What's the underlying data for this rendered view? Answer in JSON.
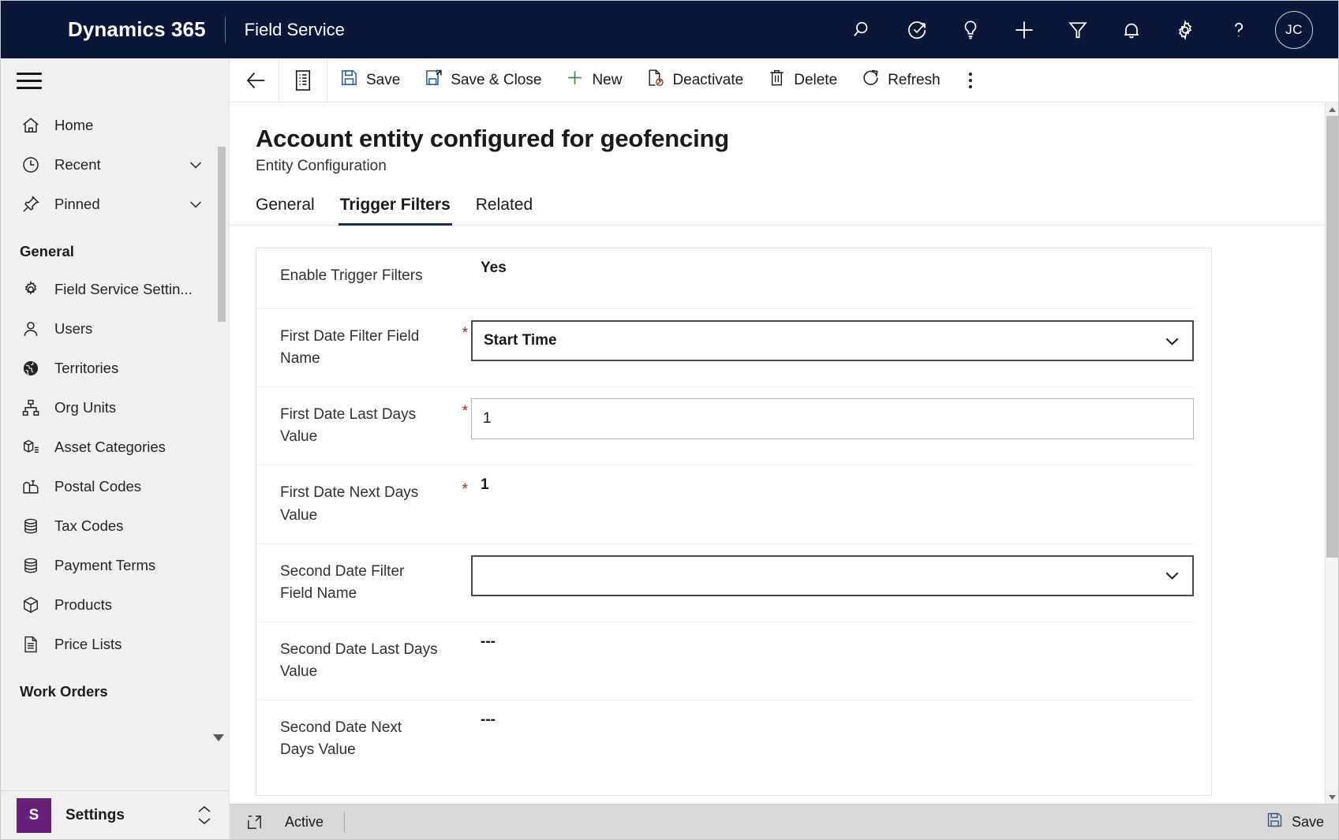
{
  "topbar": {
    "brand": "Dynamics 365",
    "app_name": "Field Service",
    "icons": [
      {
        "name": "search-icon",
        "label": "Search"
      },
      {
        "name": "assistant-check-icon",
        "label": "Assistant"
      },
      {
        "name": "lightbulb-icon",
        "label": "Ideas"
      },
      {
        "name": "plus-icon",
        "label": "Quick create"
      },
      {
        "name": "filter-funnel-icon",
        "label": "Filter"
      },
      {
        "name": "bell-icon",
        "label": "Notifications"
      },
      {
        "name": "gear-icon",
        "label": "Settings"
      },
      {
        "name": "question-icon",
        "label": "Help"
      }
    ],
    "avatar_initials": "JC"
  },
  "commandbar": {
    "back_label": "Back",
    "form_selector_label": "Form selector",
    "buttons": [
      {
        "name": "save-button",
        "label": "Save",
        "icon": "save-icon"
      },
      {
        "name": "save-and-close-button",
        "label": "Save & Close",
        "icon": "save-close-icon"
      },
      {
        "name": "new-button",
        "label": "New",
        "icon": "plus-icon"
      },
      {
        "name": "deactivate-button",
        "label": "Deactivate",
        "icon": "deactivate-icon"
      },
      {
        "name": "delete-button",
        "label": "Delete",
        "icon": "trash-icon"
      },
      {
        "name": "refresh-button",
        "label": "Refresh",
        "icon": "refresh-icon"
      }
    ],
    "overflow_label": "More commands"
  },
  "sidebar": {
    "menu_label": "Site map",
    "items": [
      {
        "label": "Home",
        "icon": "home-icon",
        "chevron": false
      },
      {
        "label": "Recent",
        "icon": "clock-icon",
        "chevron": true
      },
      {
        "label": "Pinned",
        "icon": "pin-icon",
        "chevron": true
      }
    ],
    "group_general": "General",
    "general_items": [
      {
        "label": "Field Service Settin...",
        "icon": "gear-icon"
      },
      {
        "label": "Users",
        "icon": "person-icon"
      },
      {
        "label": "Territories",
        "icon": "globe-icon"
      },
      {
        "label": "Org Units",
        "icon": "org-chart-icon"
      },
      {
        "label": "Asset Categories",
        "icon": "asset-category-icon"
      },
      {
        "label": "Postal Codes",
        "icon": "mailbox-icon"
      },
      {
        "label": "Tax Codes",
        "icon": "stack-icon"
      },
      {
        "label": "Payment Terms",
        "icon": "stack-icon"
      },
      {
        "label": "Products",
        "icon": "box-icon"
      },
      {
        "label": "Price Lists",
        "icon": "document-list-icon"
      }
    ],
    "group_work_orders": "Work Orders",
    "area_switcher": {
      "badge": "S",
      "label": "Settings"
    }
  },
  "record": {
    "title": "Account entity configured for geofencing",
    "subtitle": "Entity Configuration"
  },
  "tabs": [
    {
      "label": "General",
      "active": false
    },
    {
      "label": "Trigger Filters",
      "active": true
    },
    {
      "label": "Related",
      "active": false
    }
  ],
  "form": {
    "rows": [
      {
        "label": "Enable Trigger Filters",
        "required": false,
        "control": "static",
        "value": "Yes"
      },
      {
        "label": "First Date Filter Field Name",
        "required": true,
        "control": "select",
        "value": "Start Time",
        "focused": true
      },
      {
        "label": "First Date Last Days Value",
        "required": true,
        "control": "input",
        "value": "1",
        "focused": false
      },
      {
        "label": "First Date Next Days Value",
        "required": true,
        "control": "static",
        "value": "1"
      },
      {
        "label": "Second Date Filter Field Name",
        "required": false,
        "control": "select",
        "value": "",
        "focused": true
      },
      {
        "label": "Second Date Last Days Value",
        "required": false,
        "control": "static",
        "value": "---"
      },
      {
        "label": "Second Date Next Days Value",
        "required": false,
        "control": "static",
        "value": "---"
      }
    ]
  },
  "statusbar": {
    "popout_label": "Open in new window",
    "state": "Active",
    "save_label": "Save"
  },
  "colors": {
    "topbar_bg": "#0b1739",
    "accent": "#0f2e6b",
    "required_red": "#a4262c",
    "area_badge": "#68217a",
    "sidebar_bg": "#f0f0f0",
    "statusbar_bg": "#d9d9d9"
  }
}
